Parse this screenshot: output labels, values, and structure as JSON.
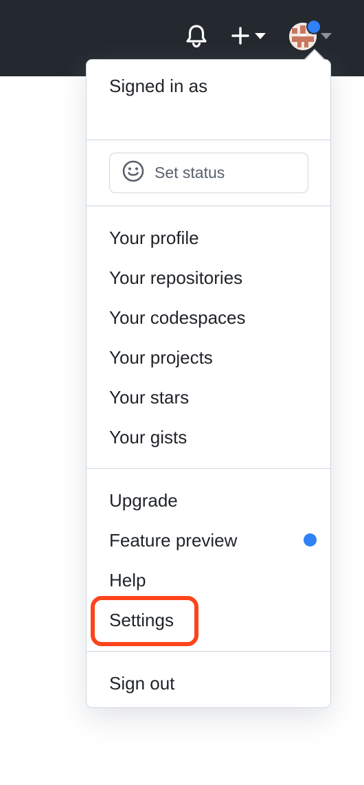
{
  "header": {
    "bell_icon": "bell-icon",
    "plus_icon": "plus-icon",
    "caret_icon": "caret-down-icon",
    "avatar_notification_color": "#2f81f7",
    "background_color": "#24292f"
  },
  "dropdown": {
    "signed_in_label": "Signed in as",
    "set_status_label": "Set status",
    "set_status_icon": "smiley-icon",
    "profile_items": [
      "Your profile",
      "Your repositories",
      "Your codespaces",
      "Your projects",
      "Your stars",
      "Your gists"
    ],
    "secondary_items": [
      "Upgrade",
      "Feature preview",
      "Help",
      "Settings"
    ],
    "sign_out_label": "Sign out",
    "highlight_color": "#fc441b",
    "highlighted_item": "Settings"
  }
}
